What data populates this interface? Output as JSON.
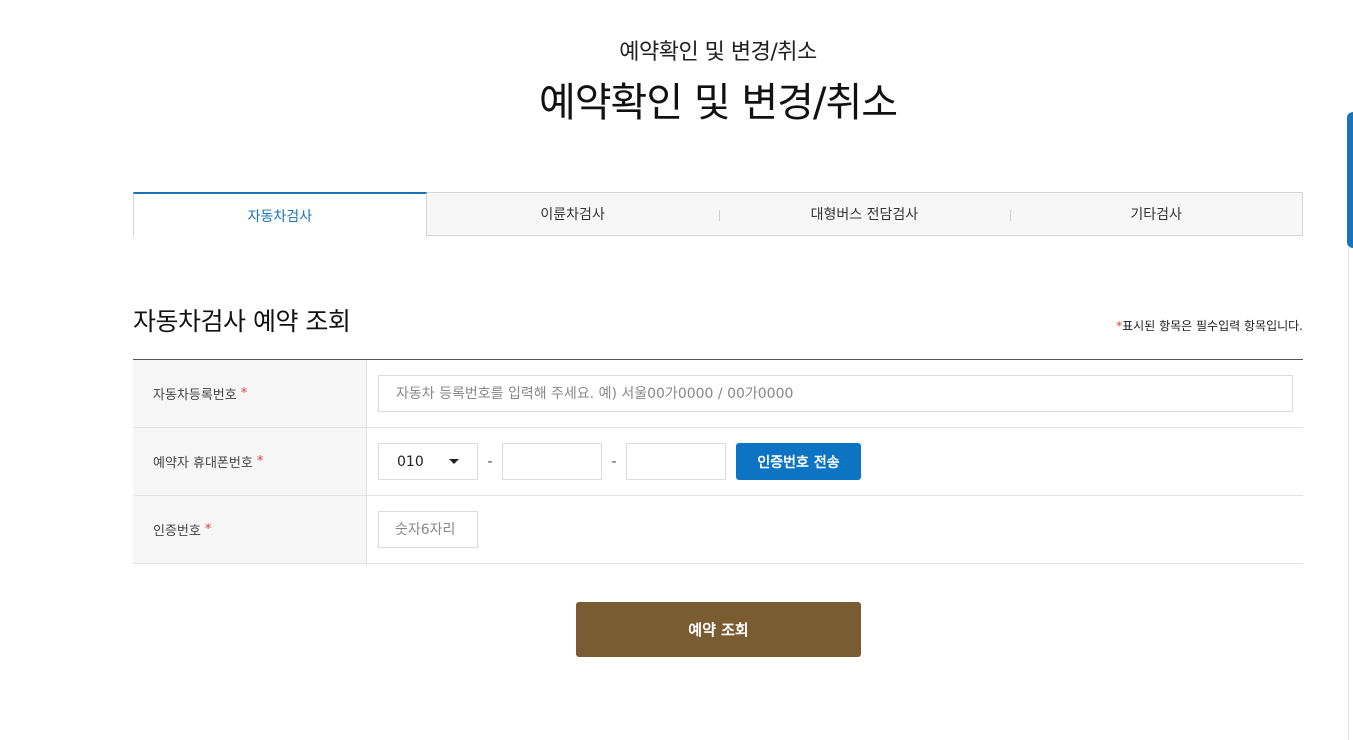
{
  "header": {
    "subtitle": "예약확인 및 변경/취소",
    "title": "예약확인 및 변경/취소"
  },
  "tabs": [
    {
      "label": "자동차검사",
      "active": true
    },
    {
      "label": "이륜차검사",
      "active": false
    },
    {
      "label": "대형버스 전담검사",
      "active": false
    },
    {
      "label": "기타검사",
      "active": false
    }
  ],
  "section": {
    "title": "자동차검사 예약 조회",
    "required_mark": "*",
    "required_note": "표시된 항목은 필수입력 항목입니다."
  },
  "form": {
    "plate": {
      "label": "자동차등록번호",
      "required_mark": "*",
      "placeholder": "자동차 등록번호를 입력해 주세요. 예) 서울00가0000 / 00가0000",
      "value": ""
    },
    "phone": {
      "label": "예약자 휴대폰번호",
      "required_mark": "*",
      "prefix_selected": "010",
      "separator": "-",
      "middle_value": "",
      "last_value": "",
      "send_button_label": "인증번호 전송"
    },
    "auth_code": {
      "label": "인증번호",
      "required_mark": "*",
      "placeholder": "숫자6자리",
      "value": ""
    }
  },
  "search_button_label": "예약 조회",
  "colors": {
    "accent_blue": "#0d74c4",
    "tab_active": "#1a73b8",
    "search_button": "#7a5c33",
    "required": "#e03b3b"
  },
  "icons": {
    "select_caret": "chevron-down-icon"
  }
}
